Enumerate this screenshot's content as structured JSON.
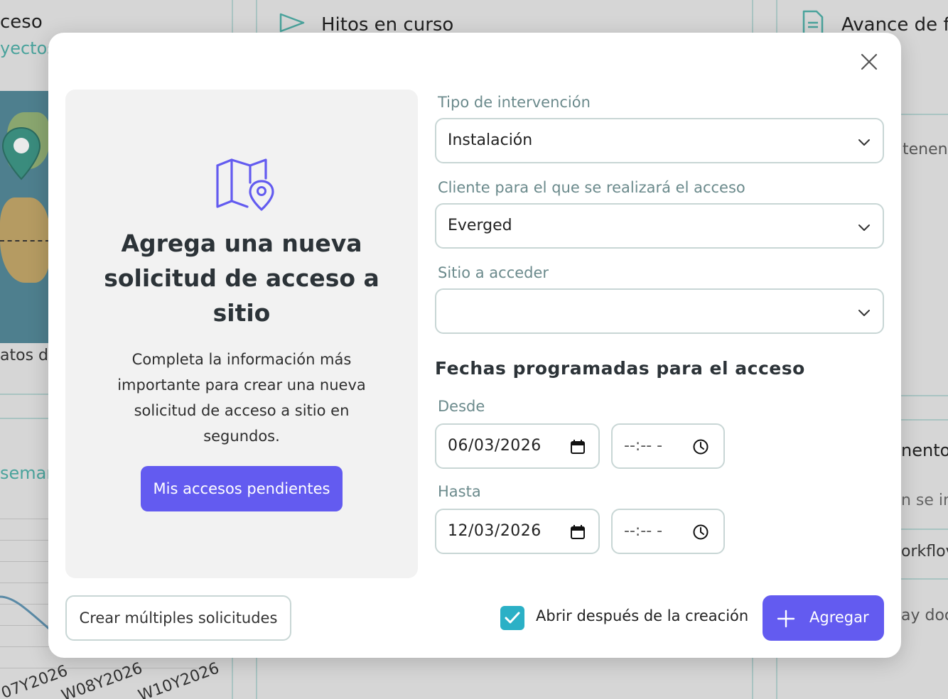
{
  "background": {
    "cards": [
      {
        "title": "ceso",
        "subtitle": "yectos"
      },
      {
        "title": "Hitos en curso"
      },
      {
        "title": "Avance de fe"
      }
    ],
    "map_caption": "atos del",
    "chart_caption": "semar",
    "right_texts": [
      "tenen",
      "nentos",
      "n se ir",
      "orkflov",
      "ay doc"
    ],
    "axis_labels": [
      "07Y2026",
      "W08Y2026",
      "W10Y2026"
    ]
  },
  "modal": {
    "promo": {
      "title": "Agrega una nueva solicitud de acceso a sitio",
      "description": "Completa la información más importante para crear una nueva solicitud de acceso a sitio en segundos.",
      "button_label": "Mis accesos pendientes"
    },
    "form": {
      "intervention_label": "Tipo de intervención",
      "intervention_value": "Instalación",
      "client_label": "Cliente para el que se realizará el acceso",
      "client_value": "Everged",
      "site_label": "Sitio a acceder",
      "site_value": "",
      "dates_title": "Fechas programadas para el acceso",
      "from_label": "Desde",
      "from_date": "06/03/2026",
      "from_time": "--:-- -",
      "to_label": "Hasta",
      "to_date": "12/03/2026",
      "to_time": "--:-- -"
    },
    "footer": {
      "multiple_label": "Crear múltiples solicitudes",
      "open_after_label": "Abrir después de la creación",
      "open_after_checked": true,
      "add_label": "Agregar"
    }
  },
  "colors": {
    "primary": "#635bf0",
    "checkbox": "#2bb0c6",
    "label": "#6b8a8c",
    "accent_teal": "#4aa39c"
  }
}
